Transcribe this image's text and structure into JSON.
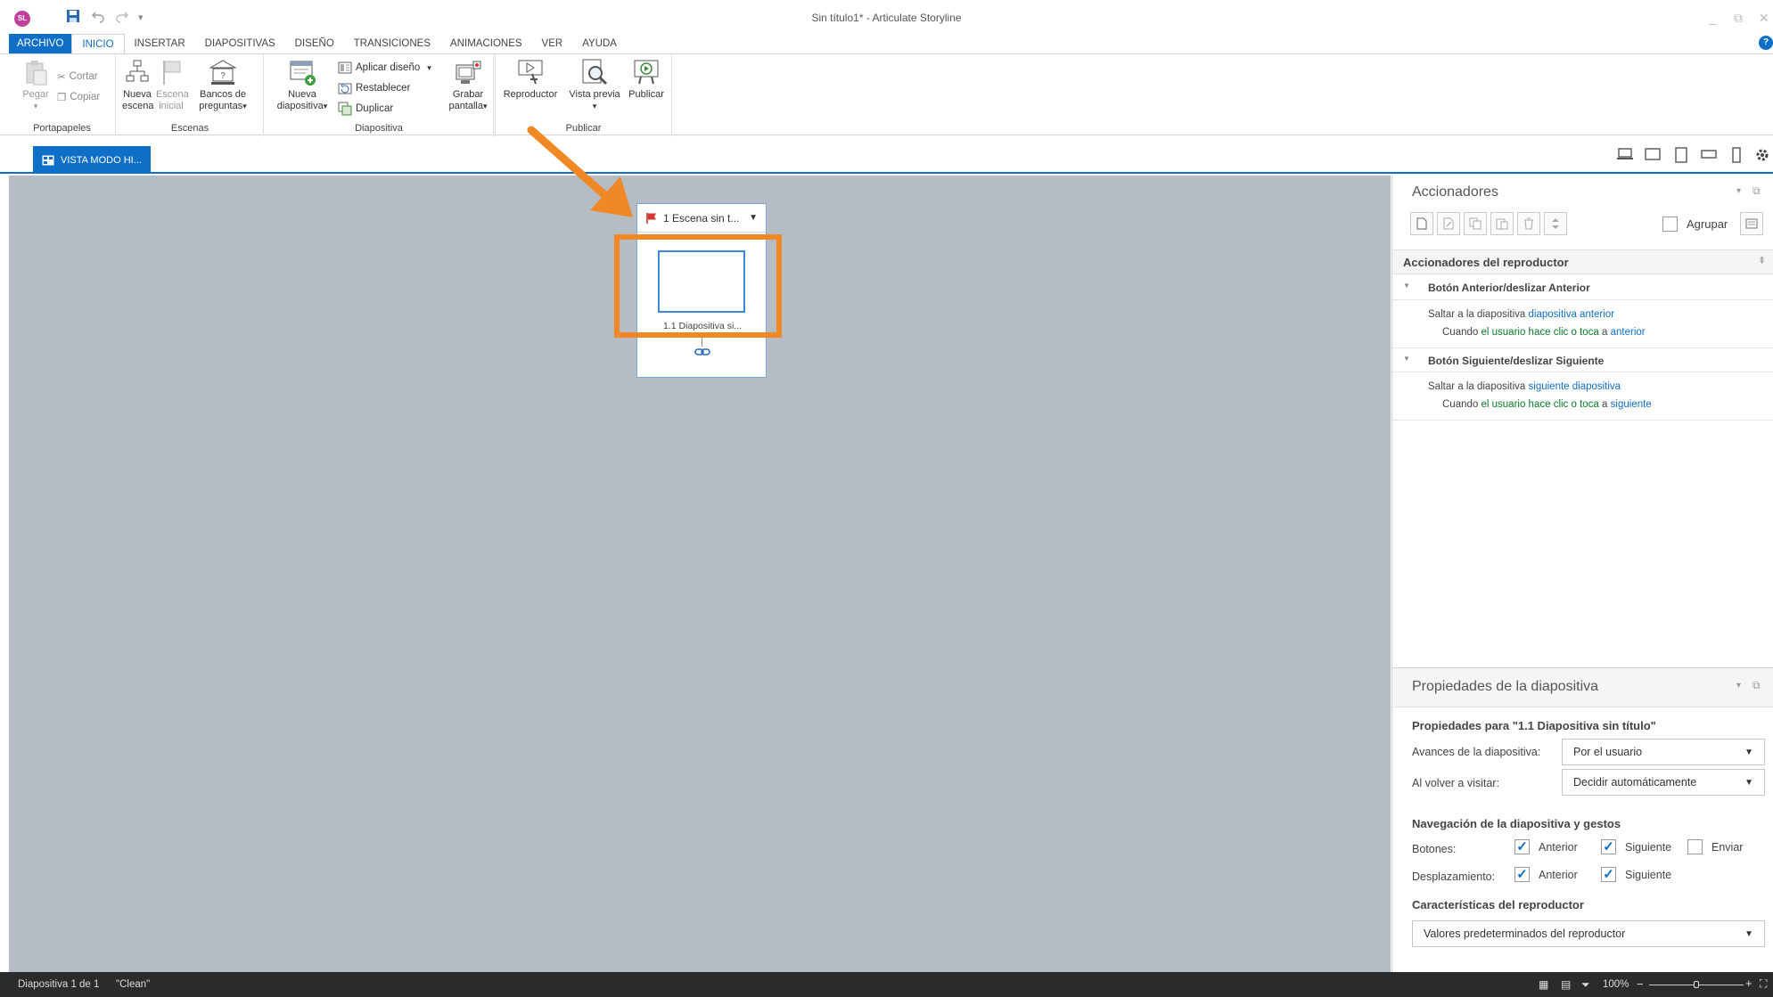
{
  "titlebar": {
    "app_badge": "SL",
    "title": "Sin título1* -  Articulate Storyline",
    "quick_access": [
      "save-icon",
      "undo-icon",
      "redo-icon",
      "customize-icon"
    ]
  },
  "tabs": {
    "file": "ARCHIVO",
    "items": [
      "INICIO",
      "INSERTAR",
      "DIAPOSITIVAS",
      "DISEÑO",
      "TRANSICIONES",
      "ANIMACIONES",
      "VER",
      "AYUDA"
    ],
    "active": "INICIO",
    "help": "?"
  },
  "ribbon": {
    "clipboard": {
      "paste": "Pegar",
      "cut": "Cortar",
      "copy": "Copiar",
      "label": "Portapapeles"
    },
    "scenes": {
      "new_scene": [
        "Nueva",
        "escena"
      ],
      "start_scene": [
        "Escena",
        "inicial"
      ],
      "question_banks": [
        "Bancos de",
        "preguntas"
      ],
      "label": "Escenas"
    },
    "slide": {
      "new_slide": [
        "Nueva",
        "diapositiva"
      ],
      "apply_layout": "Aplicar diseño",
      "reset": "Restablecer",
      "duplicate": "Duplicar",
      "label": "Diapositiva"
    },
    "record": {
      "record_screen": [
        "Grabar",
        "pantalla"
      ]
    },
    "publish": {
      "player": "Reproductor",
      "preview": "Vista previa",
      "publish": "Publicar",
      "label": "Publicar"
    }
  },
  "view_tab": {
    "label": "VISTA MODO HI..."
  },
  "canvas": {
    "scene_title": "1 Escena sin t...",
    "slide_label": "1.1 Diapositiva si..."
  },
  "triggers": {
    "title": "Accionadores",
    "group_label": "Agrupar",
    "player_triggers_title": "Accionadores del reproductor",
    "groups": [
      {
        "heading": "Botón Anterior/deslizar Anterior",
        "action_text": "Saltar a la diapositiva",
        "action_link": "diapositiva anterior",
        "when_text": "Cuando",
        "when_user": "el usuario hace clic o toca",
        "when_a": "a",
        "when_target": "anterior"
      },
      {
        "heading": "Botón Siguiente/deslizar Siguiente",
        "action_text": "Saltar a la diapositiva",
        "action_link": "siguiente diapositiva",
        "when_text": "Cuando",
        "when_user": "el usuario hace clic o toca",
        "when_a": "a",
        "when_target": "siguiente"
      }
    ]
  },
  "properties": {
    "title": "Propiedades de la diapositiva",
    "for_label": "Propiedades para \"1.1 Diapositiva sin título\"",
    "advance_label": "Avances de la diapositiva:",
    "advance_value": "Por el usuario",
    "revisit_label": "Al volver a visitar:",
    "revisit_value": "Decidir automáticamente",
    "nav_title": "Navegación de la diapositiva y gestos",
    "buttons_label": "Botones:",
    "buttons": [
      {
        "label": "Anterior",
        "checked": true
      },
      {
        "label": "Siguiente",
        "checked": true
      },
      {
        "label": "Enviar",
        "checked": false
      }
    ],
    "swipe_label": "Desplazamiento:",
    "swipe": [
      {
        "label": "Anterior",
        "checked": true
      },
      {
        "label": "Siguiente",
        "checked": true
      }
    ],
    "player_title": "Características del reproductor",
    "player_value": "Valores predeterminados del reproductor"
  },
  "status": {
    "slide_count": "Diapositiva 1 de 1",
    "theme": "\"Clean\"",
    "zoom": "100%"
  },
  "colors": {
    "accent": "#0f6fc6",
    "highlight": "#f08826",
    "canvas": "#b5bcc4"
  }
}
